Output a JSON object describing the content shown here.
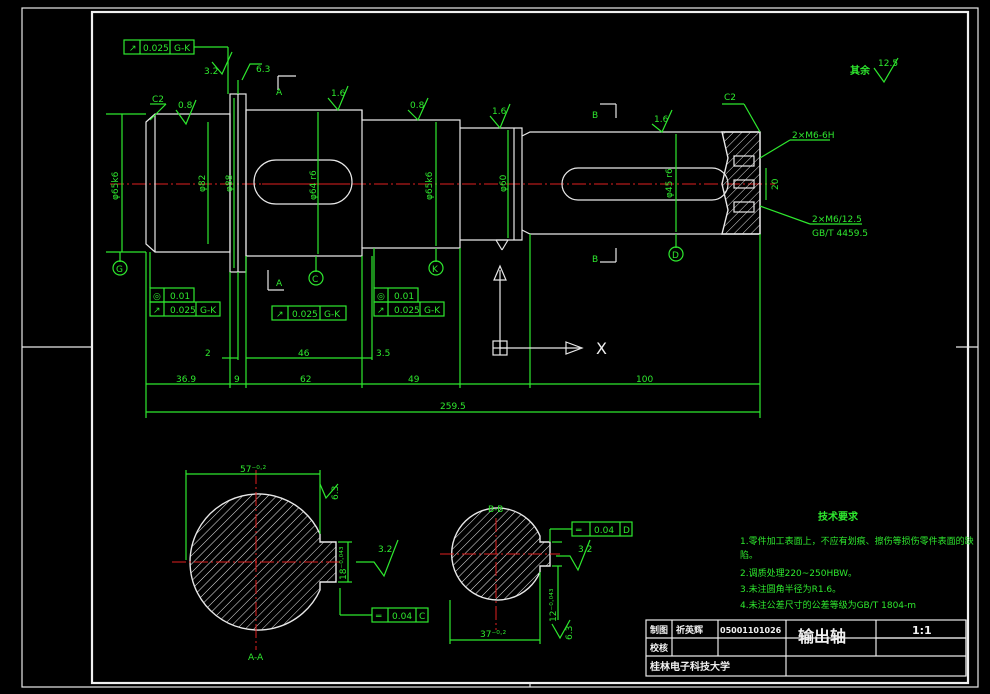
{
  "title_block": {
    "row1_label": "制图",
    "row1_name": "祈英辉",
    "row1_number": "05001101026",
    "row2_label": "校核",
    "part_name": "输出轴",
    "scale": "1:1",
    "school": "桂林电子科技大学"
  },
  "tech_requirements": {
    "title": "技术要求",
    "items": [
      "1.零件加工表面上，不应有划痕、擦伤等损伤零件表面的缺",
      "陷。",
      "2.调质处理220~250HBW。",
      "3.未注圆角半径为R1.6。",
      "4.未注公差尺寸的公差等级为GB/T 1804-m"
    ]
  },
  "roughness_other": {
    "label": "其余",
    "value": "12.5"
  },
  "dimensions": {
    "d_36": "36.9",
    "d_9": "9",
    "d_62": "62",
    "d_49": "49",
    "d_100": "100",
    "d_total": "259.5",
    "d_2": "2",
    "d_46": "46",
    "d_35": "3.5"
  },
  "diameters": {
    "left_bearing": "φ65k6",
    "shoulder": "φ82",
    "collar": "φ88",
    "gear_seat": "φ64 r6",
    "right_bearing": "φ65k6",
    "step": "φ60",
    "coupling": "φ45 r6",
    "key_width": "20"
  },
  "roughness": {
    "r1": "3.2",
    "r2": "6.3",
    "r3": "0.8",
    "r4": "1.6",
    "r5": "0.8",
    "r6": "1.6",
    "r7": "1.6"
  },
  "chamfer": {
    "left": "C2",
    "right": "C2"
  },
  "tolerance_frames": {
    "top": {
      "symbol": "↗",
      "value": "0.025",
      "datum": "G-K"
    },
    "left_cyl": {
      "symbol": "◎",
      "value": "0.01"
    },
    "left_run": {
      "symbol": "↗",
      "value": "0.025",
      "datum": "G-K"
    },
    "mid_run": {
      "symbol": "↗",
      "value": "0.025",
      "datum": "G-K"
    },
    "right_cyl": {
      "symbol": "◎",
      "value": "0.01"
    },
    "right_run": {
      "symbol": "↗",
      "value": "0.025",
      "datum": "G-K"
    },
    "section_a": {
      "symbol": "═",
      "value": "0.04",
      "datum": "C"
    },
    "section_b": {
      "symbol": "═",
      "value": "0.04",
      "datum": "D"
    }
  },
  "datums": {
    "g": "G",
    "c": "C",
    "k": "K",
    "d": "D"
  },
  "section_labels": {
    "a_arrow": "A",
    "b_arrow": "B",
    "aa": "A-A",
    "bb": "B-B"
  },
  "thread_notes": {
    "t1": "2×M6-6H",
    "t2": "2×M6/12.5",
    "t3": "GB/T 4459.5"
  },
  "sections": {
    "a_top_dim": "57⁻⁰·²",
    "a_key": "18⁻⁰·⁰⁴³",
    "a_r1": "6.3",
    "a_r2": "3.2",
    "b_top_dim": "B-B",
    "b_bottom_dim": "37⁻⁰·²",
    "b_key": "12⁻⁰·⁰⁴³",
    "b_r1": "3.2",
    "b_r2": "6.3"
  },
  "ucs": {
    "x": "X"
  }
}
